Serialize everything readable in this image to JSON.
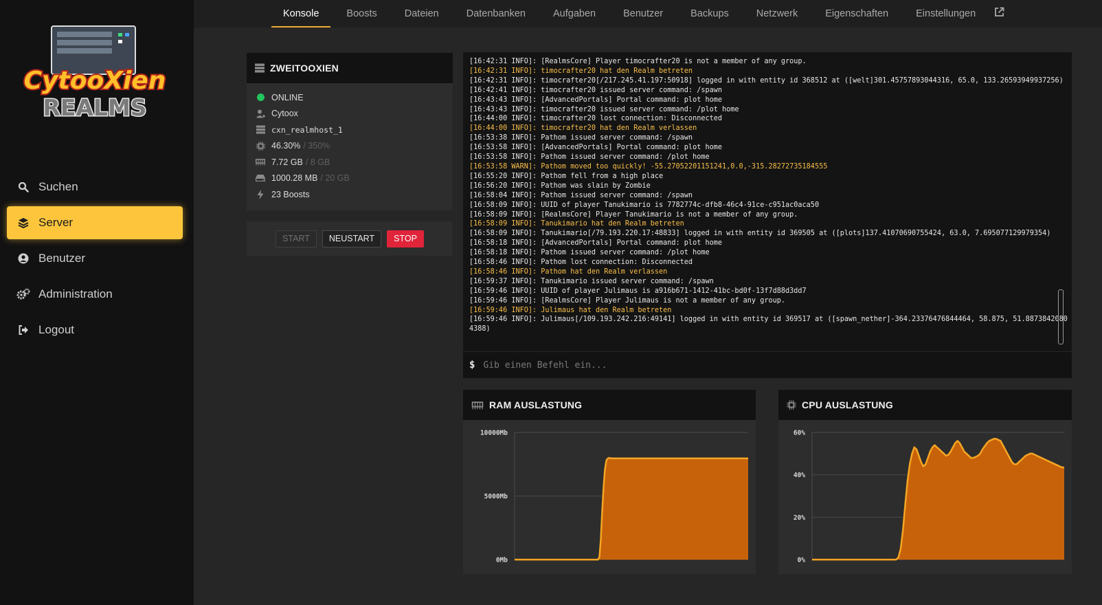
{
  "brand": {
    "logo_line1": "CytooXien",
    "logo_line2": "REALMS"
  },
  "sidebar": {
    "items": [
      {
        "label": "Suchen",
        "icon": "search-icon",
        "active": false
      },
      {
        "label": "Server",
        "icon": "layers-icon",
        "active": true
      },
      {
        "label": "Benutzer",
        "icon": "user-circle-icon",
        "active": false
      },
      {
        "label": "Administration",
        "icon": "gears-icon",
        "active": false
      },
      {
        "label": "Logout",
        "icon": "logout-icon",
        "active": false
      }
    ]
  },
  "tabs": [
    "Konsole",
    "Boosts",
    "Dateien",
    "Datenbanken",
    "Aufgaben",
    "Benutzer",
    "Backups",
    "Netzwerk",
    "Eigenschaften",
    "Einstellungen"
  ],
  "active_tab": "Konsole",
  "server": {
    "name": "ZWEITOOXIEN",
    "status": "ONLINE",
    "owner": "Cytoox",
    "host": "cxn_realmhost_1",
    "cpu": "46.30%",
    "cpu_limit": "/ 350%",
    "ram": "7.72 GB",
    "ram_limit": "/ 8 GB",
    "disk": "1000.28 MB",
    "disk_limit": "/ 20 GB",
    "boosts": "23 Boosts"
  },
  "controls": {
    "start": "START",
    "restart": "NEUSTART",
    "stop": "STOP"
  },
  "console": {
    "lines": [
      {
        "text": "[16:42:31 INFO]: [RealmsCore] Player timocrafter20 is not a member of any group.",
        "highlight": false
      },
      {
        "text": "[16:42:31 INFO]: timocrafter20 hat den Realm betreten",
        "highlight": true
      },
      {
        "text": "[16:42:31 INFO]: timocrafter20[/217.245.41.197:50918] logged in with entity id 368512 at ([welt]301.45757893044316, 65.0, 133.26593949937256)",
        "highlight": false
      },
      {
        "text": "[16:42:41 INFO]: timocrafter20 issued server command: /spawn",
        "highlight": false
      },
      {
        "text": "[16:43:43 INFO]: [AdvancedPortals] Portal command: plot home",
        "highlight": false
      },
      {
        "text": "[16:43:43 INFO]: timocrafter20 issued server command: /plot home",
        "highlight": false
      },
      {
        "text": "[16:44:00 INFO]: timocrafter20 lost connection: Disconnected",
        "highlight": false
      },
      {
        "text": "[16:44:00 INFO]: timocrafter20 hat den Realm verlassen",
        "highlight": true
      },
      {
        "text": "[16:53:38 INFO]: Pathom issued server command: /spawn",
        "highlight": false
      },
      {
        "text": "[16:53:58 INFO]: [AdvancedPortals] Portal command: plot home",
        "highlight": false
      },
      {
        "text": "[16:53:58 INFO]: Pathom issued server command: /plot home",
        "highlight": false
      },
      {
        "text": "[16:53:58 WARN]: Pathom moved too quickly! -55.27052201151241,0.0,-315.28272735184555",
        "highlight": true
      },
      {
        "text": "[16:55:20 INFO]: Pathom fell from a high place",
        "highlight": false
      },
      {
        "text": "[16:56:20 INFO]: Pathom was slain by Zombie",
        "highlight": false
      },
      {
        "text": "[16:58:04 INFO]: Pathom issued server command: /spawn",
        "highlight": false
      },
      {
        "text": "[16:58:09 INFO]: UUID of player Tanukimario is 7782774c-dfb8-46c4-91ce-c951ac0aca50",
        "highlight": false
      },
      {
        "text": "[16:58:09 INFO]: [RealmsCore] Player Tanukimario is not a member of any group.",
        "highlight": false
      },
      {
        "text": "[16:58:09 INFO]: Tanukimario hat den Realm betreten",
        "highlight": true
      },
      {
        "text": "[16:58:09 INFO]: Tanukimario[/79.193.220.17:48833] logged in with entity id 369505 at ([plots]137.41070690755424, 63.0, 7.695077129979354)",
        "highlight": false
      },
      {
        "text": "[16:58:18 INFO]: [AdvancedPortals] Portal command: plot home",
        "highlight": false
      },
      {
        "text": "[16:58:18 INFO]: Pathom issued server command: /plot home",
        "highlight": false
      },
      {
        "text": "[16:58:46 INFO]: Pathom lost connection: Disconnected",
        "highlight": false
      },
      {
        "text": "[16:58:46 INFO]: Pathom hat den Realm verlassen",
        "highlight": true
      },
      {
        "text": "[16:59:37 INFO]: Tanukimario issued server command: /spawn",
        "highlight": false
      },
      {
        "text": "[16:59:46 INFO]: UUID of player Julimaus is a916b671-1412-41bc-bd0f-13f7d88d3dd7",
        "highlight": false
      },
      {
        "text": "[16:59:46 INFO]: [RealmsCore] Player Julimaus is not a member of any group.",
        "highlight": false
      },
      {
        "text": "[16:59:46 INFO]: Julimaus hat den Realm betreten",
        "highlight": true
      },
      {
        "text": "[16:59:46 INFO]: Julimaus[/109.193.242.216:49141] logged in with entity id 369517 at ([spawn_nether]-364.23376476844464, 58.875, 51.8873842080",
        "highlight": false
      },
      {
        "text": "4388)",
        "highlight": false
      }
    ],
    "prompt": "$",
    "placeholder": "Gib einen Befehl ein..."
  },
  "colors": {
    "accent": "#fcc53c",
    "chart_line": "#f5a623",
    "chart_fill": "#c8620a",
    "online": "#22c55e",
    "stop": "#e0243a"
  },
  "chart_data": [
    {
      "type": "area",
      "title": "RAM AUSLASTUNG",
      "ylim": [
        0,
        10000
      ],
      "yticks": [
        "10000Mb",
        "5000Mb",
        "0Mb"
      ],
      "grid": true,
      "legend": "none",
      "series": [
        {
          "values": [
            0,
            0,
            0,
            0,
            0,
            0,
            0,
            0,
            0,
            0,
            0,
            0,
            0,
            0,
            0,
            0,
            0,
            0,
            0,
            0,
            0,
            0,
            0,
            0,
            0,
            0,
            0,
            0,
            0,
            0,
            0,
            0,
            0,
            0,
            0,
            0,
            0,
            0,
            0,
            0,
            0,
            0,
            0,
            0,
            0,
            0,
            0,
            0,
            0,
            0,
            0,
            0,
            0,
            0,
            0,
            0,
            0,
            0,
            0,
            0,
            0,
            200,
            1600,
            3800,
            5700,
            7100,
            7800,
            7950,
            8000,
            7970,
            7960,
            7960,
            7960,
            7960,
            7960,
            7960,
            7960,
            7960,
            7960,
            7960,
            7960,
            7960,
            7960,
            7960,
            7960,
            7960,
            7960,
            7960,
            7960,
            7960,
            7960,
            7960,
            7960,
            7960,
            7960,
            7960,
            7960,
            7960,
            7960,
            7960,
            7960,
            7960,
            7960,
            7960,
            7960,
            7960,
            7960,
            7960,
            7960,
            7960,
            7960,
            7960,
            7960,
            7960,
            7960,
            7960,
            7960,
            7960,
            7960,
            7960,
            7960,
            7960,
            7960,
            7960,
            7960,
            7960,
            7960,
            7960,
            7960,
            7960,
            7960,
            7960,
            7960,
            7960,
            7960,
            7960,
            7960,
            7960,
            7960,
            7960,
            7960,
            7960,
            7960,
            7960,
            7960,
            7960,
            7960,
            7960,
            7960,
            7960,
            7960,
            7960,
            7960,
            7960,
            7960,
            7960,
            7960,
            7960,
            7960,
            7960,
            7960,
            7960,
            7960,
            7960,
            7960,
            7960,
            7960,
            7960,
            7960
          ]
        }
      ]
    },
    {
      "type": "area",
      "title": "CPU AUSLASTUNG",
      "ylim": [
        0,
        60
      ],
      "yticks": [
        "60%",
        "40%",
        "20%",
        "0%"
      ],
      "grid": true,
      "legend": "none",
      "series": [
        {
          "values": [
            0,
            0,
            0,
            0,
            0,
            0,
            0,
            0,
            0,
            0,
            0,
            0,
            0,
            0,
            0,
            0,
            0,
            0,
            0,
            0,
            0,
            0,
            0,
            0,
            0,
            0,
            0,
            0,
            0,
            0,
            0,
            0,
            0,
            0,
            0,
            0,
            0,
            0,
            1,
            5,
            14,
            26,
            37,
            45,
            50,
            53,
            52,
            49,
            46,
            44,
            45,
            48,
            51,
            53,
            54,
            53,
            52,
            51,
            50,
            49,
            49.5,
            51,
            53,
            55,
            56,
            55,
            53,
            51,
            50,
            49,
            48,
            48,
            48.5,
            49,
            50,
            52,
            53.5,
            55,
            56,
            56.5,
            57,
            57,
            56.5,
            56,
            54,
            52,
            50,
            48,
            46,
            45,
            45,
            46,
            47,
            48,
            49,
            49.5,
            50,
            50,
            49.5,
            49,
            48.5,
            48,
            47.5,
            47,
            46.5,
            46,
            45.5,
            45,
            44.5,
            44,
            43.5,
            43.5
          ]
        }
      ]
    }
  ]
}
